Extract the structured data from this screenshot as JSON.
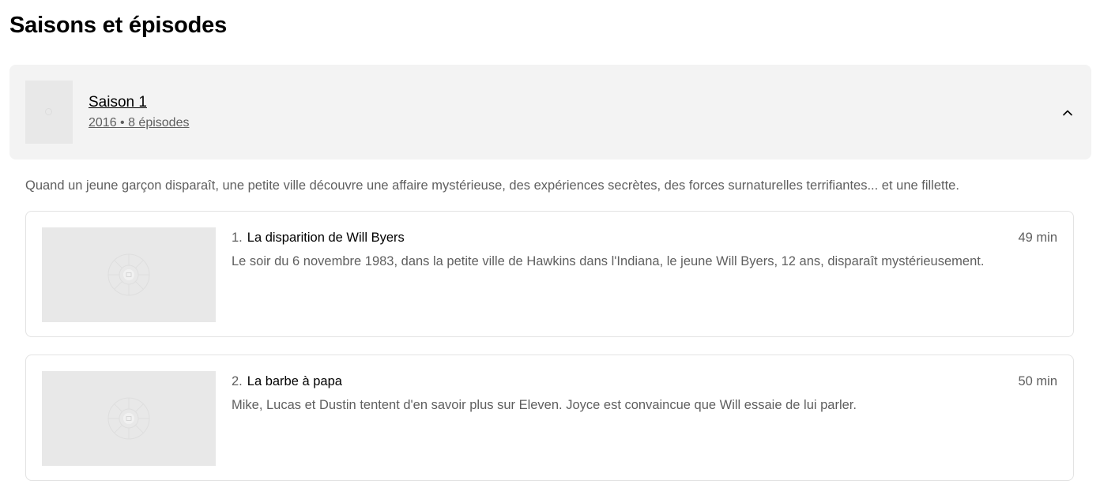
{
  "header": {
    "title": "Saisons et épisodes"
  },
  "season": {
    "title": "Saison 1",
    "meta": "2016 • 8 épisodes",
    "expanded": true,
    "description": "Quand un jeune garçon disparaît, une petite ville découvre une affaire mystérieuse, des expériences secrètes, des forces surnaturelles terrifiantes... et une fillette."
  },
  "episodes": [
    {
      "number": "1.",
      "title": "La disparition de Will Byers",
      "duration": "49 min",
      "description": "Le soir du 6 novembre 1983, dans la petite ville de Hawkins dans l'Indiana, le jeune Will Byers, 12 ans, disparaît mystérieusement."
    },
    {
      "number": "2.",
      "title": "La barbe à papa",
      "duration": "50 min",
      "description": "Mike, Lucas et Dustin tentent d'en savoir plus sur Eleven. Joyce est convaincue que Will essaie de lui parler."
    }
  ],
  "colors": {
    "panel_bg": "#f3f3f3",
    "thumb_bg": "#e8e8e8",
    "muted_text": "#5f5f5f",
    "card_border": "#e3e3e3"
  },
  "icons": {
    "expand": "chevron-up-icon",
    "placeholder": "image-placeholder-icon"
  }
}
